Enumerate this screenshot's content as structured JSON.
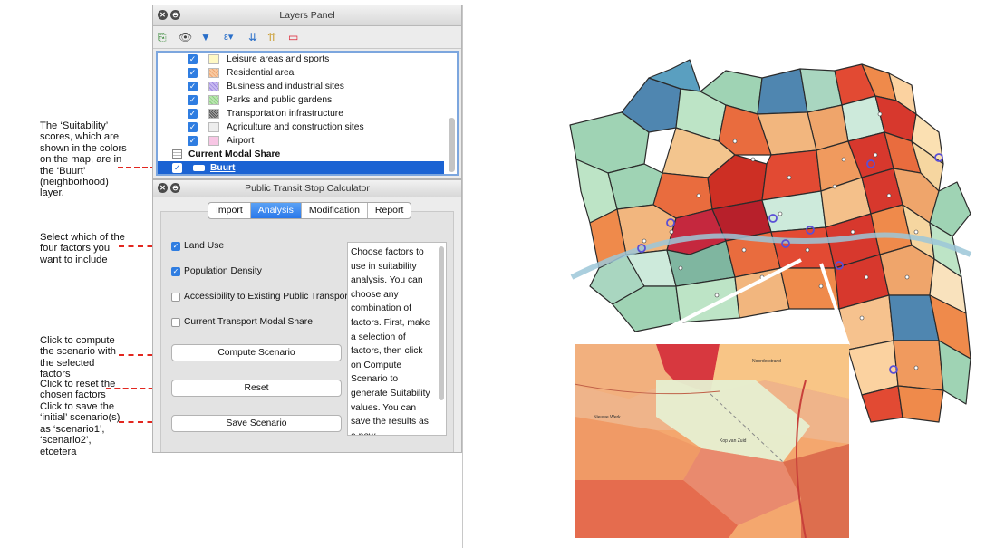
{
  "annotations": [
    {
      "text": "The ‘Suitability’ scores, which are shown in the colors on the map, are in the ‘Buurt’ (neighborhood) layer."
    },
    {
      "text": "Select which of the four factors you want to include"
    },
    {
      "text": "Click to compute the scenario with the selected factors"
    },
    {
      "text": "Click to reset the chosen factors"
    },
    {
      "text": "Click to save the ‘initial’ scenario(s) as ‘scenario1’, ‘scenario2’, etcetera"
    }
  ],
  "layers_panel": {
    "title": "Layers Panel",
    "toolbar_icons": [
      "add-layer-icon",
      "visibility-icon",
      "filter-icon",
      "expression-filter-icon",
      "expand-all-icon",
      "collapse-all-icon",
      "remove-layer-icon"
    ],
    "items": [
      {
        "label": "Leisure areas and sports",
        "checked": true,
        "swatch": "#fff9c4"
      },
      {
        "label": "Residential area",
        "checked": true,
        "swatch": "#f8c9a0"
      },
      {
        "label": "Business and industrial sites",
        "checked": true,
        "swatch": "#c7b9f0"
      },
      {
        "label": "Parks and public gardens",
        "checked": true,
        "swatch": "#b9e4b0"
      },
      {
        "label": "Transportation infrastructure",
        "checked": true,
        "swatch": "#6f6f6f"
      },
      {
        "label": "Agriculture and construction sites",
        "checked": true,
        "swatch": "#e8e8e8"
      },
      {
        "label": "Airport",
        "checked": true,
        "swatch": "#f7c6e4"
      }
    ],
    "group_label": "Current Modal Share",
    "selected_layer": "Buurt"
  },
  "calculator": {
    "title": "Public Transit Stop Calculator",
    "tabs": [
      "Import",
      "Analysis",
      "Modification",
      "Report"
    ],
    "active_tab": "Analysis",
    "factors": [
      {
        "label": "Land Use",
        "checked": true
      },
      {
        "label": "Population Density",
        "checked": true
      },
      {
        "label": "Accessibility to Existing Public Transport",
        "checked": false
      },
      {
        "label": "Current Transport Modal Share",
        "checked": false
      }
    ],
    "buttons": {
      "compute": "Compute Scenario",
      "reset": "Reset",
      "save": "Save Scenario"
    },
    "help_text": "Choose factors to use in suitability analysis. You can choose any combination of factors. First, make a selection of factors, then click on Compute Scenario to generate Suitability values. You can save the results as a new"
  },
  "map": {
    "inset_labels": [
      "Noorderstrand",
      "Nieuwe Werk",
      "Kop van Zuid"
    ],
    "colors": {
      "high": "#d7382d",
      "mid": "#ef8a4b",
      "low": "#f6d6a0",
      "green": "#9fd3b4",
      "blue": "#4f86b0"
    }
  }
}
